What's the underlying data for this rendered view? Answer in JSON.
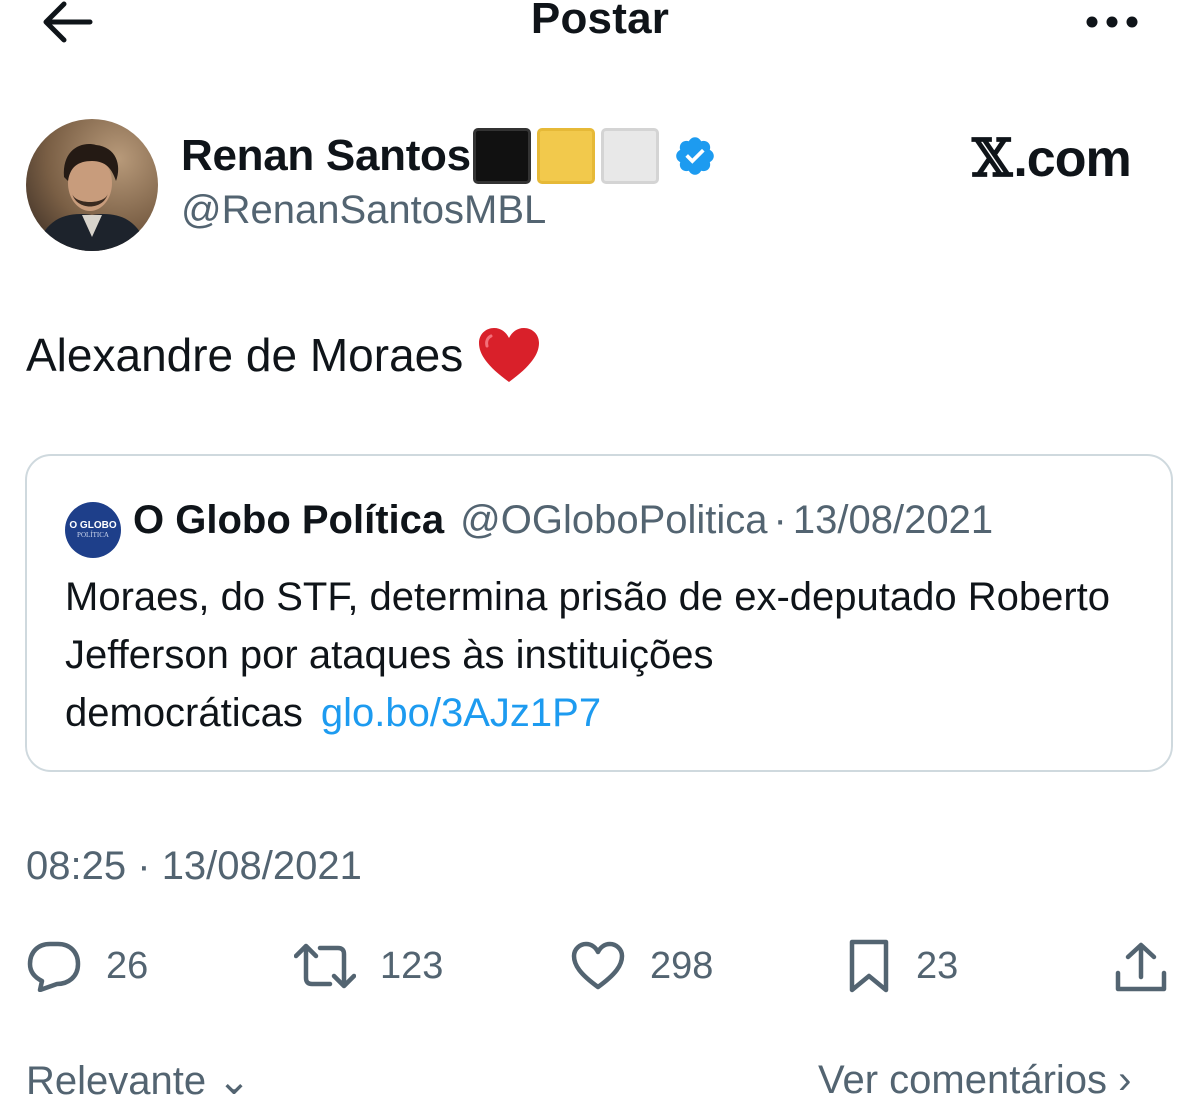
{
  "header": {
    "title": "Postar",
    "back_icon": "arrow-left-icon",
    "more_icon": "more-horizontal-icon"
  },
  "author": {
    "name": "Renan Santos",
    "handle": "@RenanSantosMBL",
    "verified": true,
    "verified_color": "#1d9bf0",
    "name_emoji": [
      "black-square",
      "yellow-square",
      "white-square"
    ]
  },
  "source_badge": {
    "logo": "𝕏",
    "suffix": ".com"
  },
  "tweet": {
    "text": "Alexandre de Moraes",
    "emoji": "red-heart"
  },
  "quote": {
    "avatar_line1": "O GLOBO",
    "avatar_line2": "POLÍTICA",
    "name": "O Globo Política",
    "handle": "@OGloboPolitica",
    "separator": "·",
    "date": "13/08/2021",
    "text": "Moraes, do STF, determina prisão de ex-deputado Roberto Jefferson por ataques às instituições democráticas",
    "link": "glo.bo/3AJz1P7",
    "link_color": "#1d9bf0"
  },
  "meta": {
    "time": "08:25",
    "separator": "·",
    "date": "13/08/2021"
  },
  "actions": {
    "replies": "26",
    "retweets": "123",
    "likes": "298",
    "bookmarks": "23"
  },
  "footer": {
    "sort_label": "Relevante",
    "view_comments": "Ver comentários"
  }
}
